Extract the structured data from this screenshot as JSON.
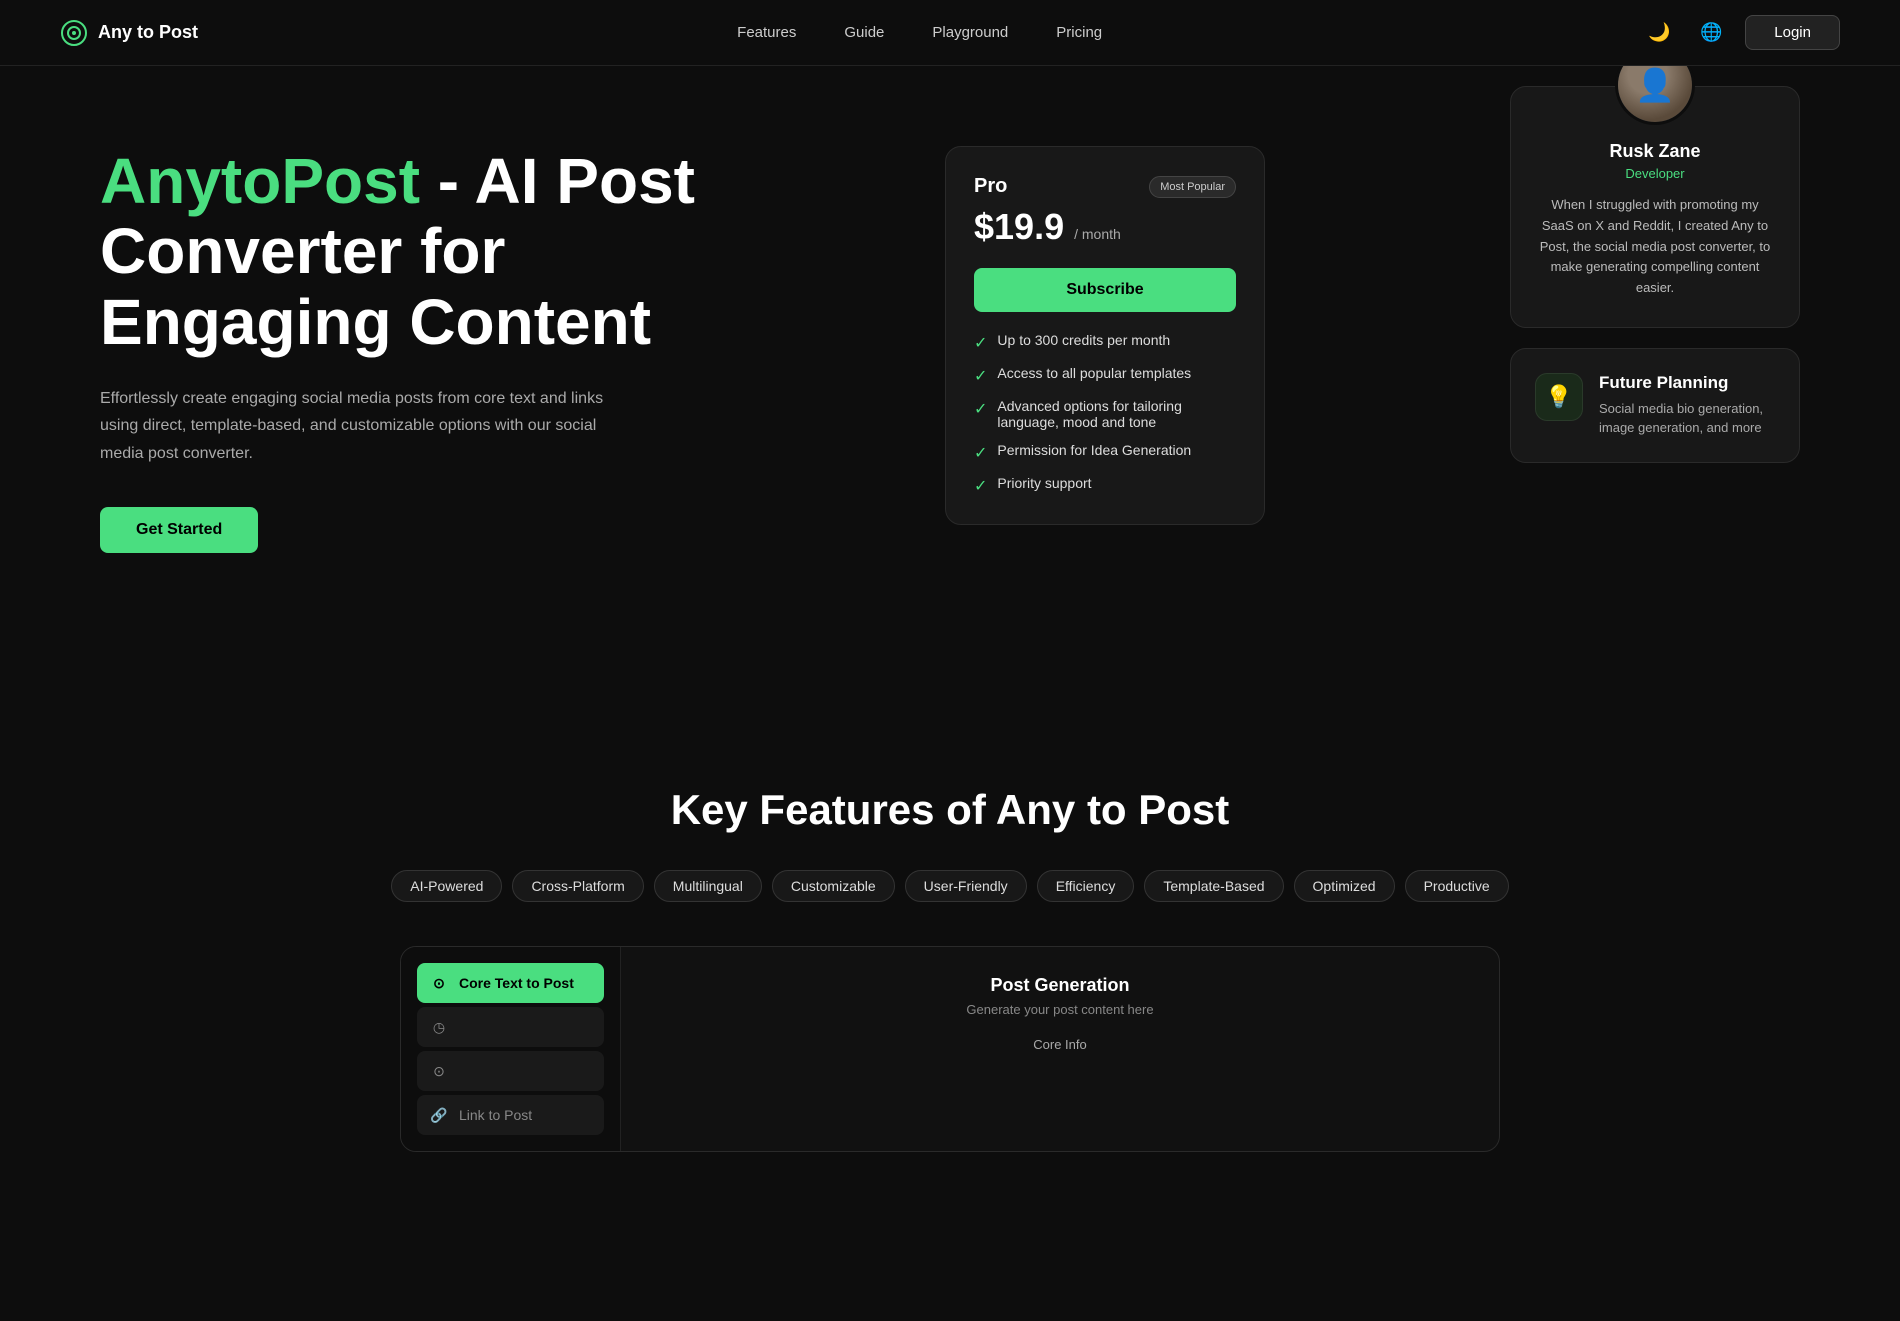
{
  "nav": {
    "logo_text": "Any to Post",
    "links": [
      {
        "label": "Features",
        "href": "#features"
      },
      {
        "label": "Guide",
        "href": "#guide"
      },
      {
        "label": "Playground",
        "href": "#playground"
      },
      {
        "label": "Pricing",
        "href": "#pricing"
      }
    ],
    "login_label": "Login",
    "theme_icon": "🌙",
    "globe_icon": "🌐"
  },
  "hero": {
    "title_green": "AnytoPost",
    "title_white": " - AI Post Converter for Engaging Content",
    "subtitle": "Effortlessly create engaging social media posts from core text and links using direct, template-based, and customizable options with our social media post converter.",
    "cta_label": "Get Started"
  },
  "pricing": {
    "plan": "Pro",
    "badge": "Most Popular",
    "price": "$19.9",
    "per_month": "/ month",
    "subscribe_label": "Subscribe",
    "features": [
      "Up to 300 credits per month",
      "Access to all popular templates",
      "Advanced options for tailoring language, mood and tone",
      "Permission for Idea Generation",
      "Priority support"
    ]
  },
  "testimonial": {
    "name": "Rusk Zane",
    "role": "Developer",
    "text": "When I struggled with promoting my SaaS on X and Reddit, I created Any to Post, the social media post converter, to make generating compelling content easier."
  },
  "future": {
    "icon": "💡",
    "title": "Future Planning",
    "description": "Social media bio generation, image generation, and more"
  },
  "features_section": {
    "title": "Key Features of Any to Post",
    "tags": [
      {
        "label": "AI-Powered",
        "active": false
      },
      {
        "label": "Cross-Platform",
        "active": false
      },
      {
        "label": "Multilingual",
        "active": false
      },
      {
        "label": "Customizable",
        "active": false
      },
      {
        "label": "User-Friendly",
        "active": false
      },
      {
        "label": "Efficiency",
        "active": false
      },
      {
        "label": "Template-Based",
        "active": false
      },
      {
        "label": "Optimized",
        "active": false
      },
      {
        "label": "Productive",
        "active": false
      }
    ],
    "demo": {
      "sidebar_items": [
        {
          "label": "Core Text to Post",
          "icon": "⊙",
          "active": true
        },
        {
          "label": "",
          "icon": "◷",
          "active": false
        },
        {
          "label": "",
          "icon": "⊙",
          "active": false
        }
      ],
      "sidebar_bottom_item": "Link to Post",
      "main_title": "Post Generation",
      "main_subtitle": "Generate your post content here",
      "main_label": "Core Info"
    }
  }
}
